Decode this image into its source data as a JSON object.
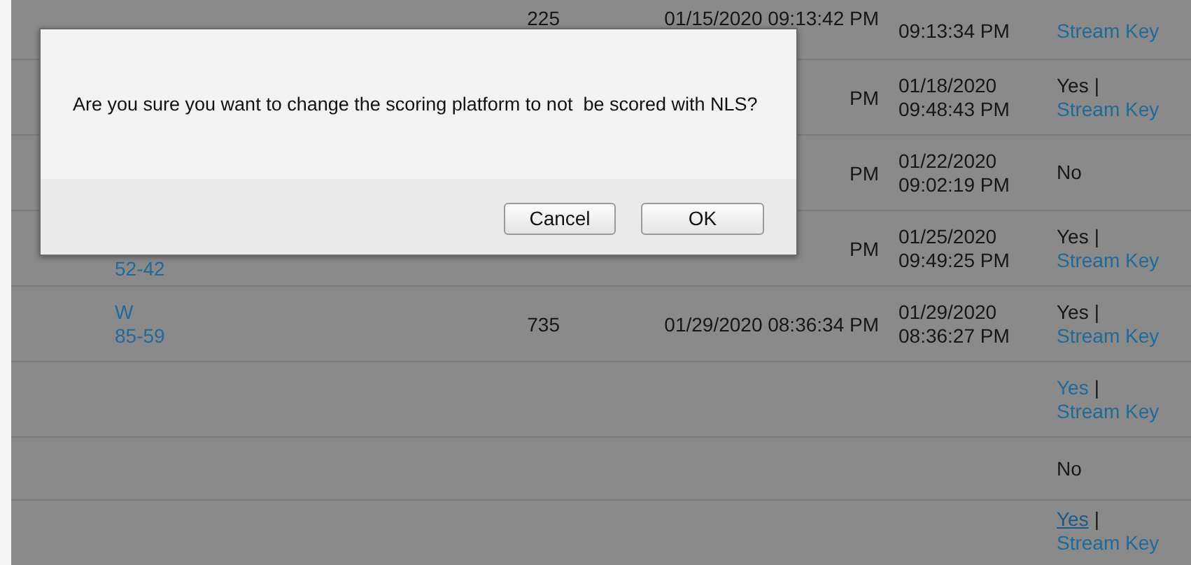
{
  "table": {
    "rows": [
      {
        "count": "225",
        "sent": "01/15/2020 09:13:42 PM",
        "date": [
          "09:13:34 PM"
        ],
        "streaming": {
          "link": "Stream Key"
        }
      },
      {
        "sent": "PM",
        "date": [
          "01/18/2020",
          "09:48:43 PM"
        ],
        "streaming": {
          "answer": "Yes",
          "answer_link": false,
          "separator": "|",
          "link": "Stream Key"
        }
      },
      {
        "sent": "PM",
        "date": [
          "01/22/2020",
          "09:02:19 PM"
        ],
        "streaming": {
          "answer": "No",
          "answer_link": false
        }
      },
      {
        "result": [
          "52-42"
        ],
        "sent": "PM",
        "date": [
          "01/25/2020",
          "09:49:25 PM"
        ],
        "streaming": {
          "answer": "Yes",
          "answer_link": false,
          "separator": "|",
          "link": "Stream Key"
        }
      },
      {
        "result": [
          "W",
          "85-59"
        ],
        "count": "735",
        "sent": "01/29/2020 08:36:34 PM",
        "date": [
          "01/29/2020",
          "08:36:27 PM"
        ],
        "streaming": {
          "answer": "Yes",
          "answer_link": false,
          "separator": "|",
          "link": "Stream Key"
        }
      },
      {
        "streaming": {
          "answer": "Yes",
          "answer_link": true,
          "hovered": false,
          "separator": "|",
          "link": "Stream Key"
        }
      },
      {
        "streaming": {
          "answer": "No",
          "answer_link": false
        }
      },
      {
        "streaming": {
          "answer": "Yes",
          "answer_link": true,
          "hovered": true,
          "separator": "|",
          "link": "Stream Key"
        }
      }
    ]
  },
  "dialog": {
    "message": "Are you sure you want to change the scoring platform to not  be scored with NLS?",
    "buttons": [
      {
        "label": "Cancel"
      },
      {
        "label": "OK"
      }
    ]
  }
}
